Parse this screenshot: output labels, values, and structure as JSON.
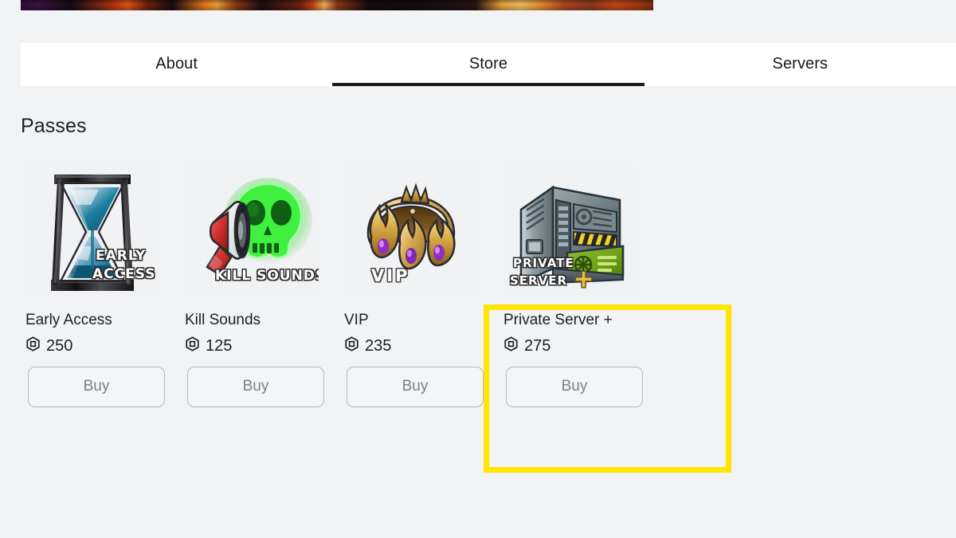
{
  "banner": {
    "name": "game-banner-image"
  },
  "tabs": [
    {
      "label": "About",
      "active": false
    },
    {
      "label": "Store",
      "active": true
    },
    {
      "label": "Servers",
      "active": false
    }
  ],
  "section": {
    "title": "Passes"
  },
  "currency": {
    "icon": "robux-icon"
  },
  "passes": [
    {
      "name": "Early Access",
      "price": "250",
      "buy_label": "Buy",
      "thumb_icon": "hourglass-icon",
      "thumb_caption_line1": "EARLY",
      "thumb_caption_line2": "ACCESS",
      "highlighted": false
    },
    {
      "name": "Kill Sounds",
      "price": "125",
      "buy_label": "Buy",
      "thumb_icon": "megaphone-skull-icon",
      "thumb_caption_line1": "KILL SOUNDS",
      "thumb_caption_line2": "",
      "highlighted": false
    },
    {
      "name": "VIP",
      "price": "235",
      "buy_label": "Buy",
      "thumb_icon": "flame-crown-icon",
      "thumb_caption_line1": "VIP",
      "thumb_caption_line2": "",
      "highlighted": false
    },
    {
      "name": "Private Server +",
      "price": "275",
      "buy_label": "Buy",
      "thumb_icon": "server-rack-icon",
      "thumb_caption_line1": "PRIVATE",
      "thumb_caption_line2": "SERVER",
      "highlighted": true
    }
  ],
  "highlight": {
    "color": "#ffe600",
    "target": "Private Server +"
  },
  "colors": {
    "page_background": "#f1f3f5",
    "tabbar_background": "#ffffff",
    "active_tab_underline": "#1b1b1b",
    "text_primary": "#1b1f22",
    "buy_text": "#7b8084",
    "buy_border": "#b6b9bc",
    "highlight_yellow": "#ffe600"
  }
}
